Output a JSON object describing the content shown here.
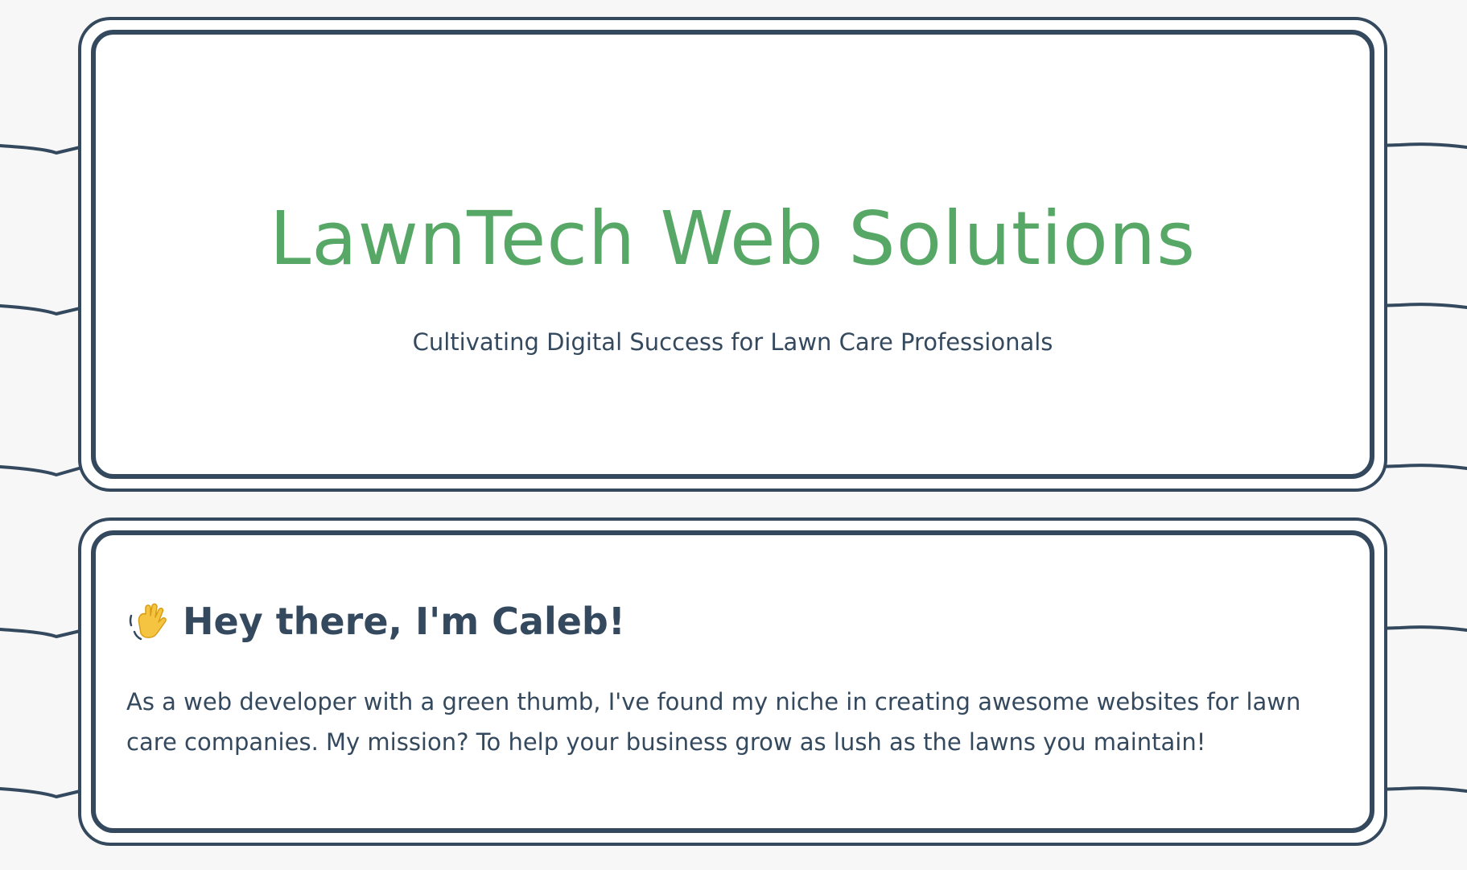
{
  "header": {
    "title": "LawnTech Web Solutions",
    "tagline": "Cultivating Digital Success for Lawn Care Professionals"
  },
  "about": {
    "icon": "waving-hand-icon",
    "heading": "Hey there, I'm Caleb!",
    "body": "As a web developer with a green thumb, I've found my niche in creating awesome websites for lawn care companies. My mission? To help your business grow as lush as the lawns you maintain!"
  },
  "colors": {
    "background": "#f7f7f7",
    "card": "#ffffff",
    "border": "#34495e",
    "accent_green": "#57a866",
    "text": "#34495e"
  }
}
